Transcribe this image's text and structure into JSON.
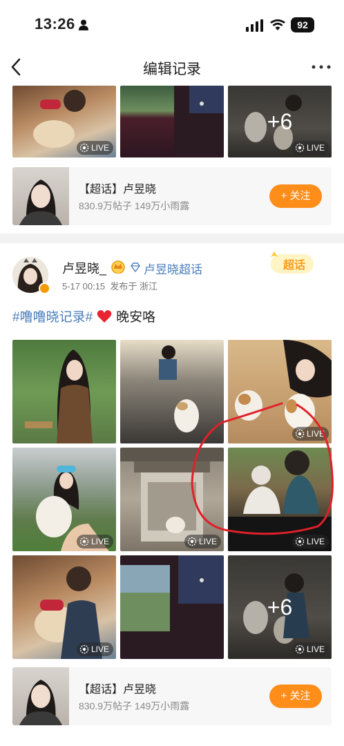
{
  "status_bar": {
    "time": "13:26",
    "battery": "92"
  },
  "nav": {
    "title": "编辑记录"
  },
  "card1": {
    "photos": [
      {
        "live": "LIVE"
      },
      {
        "live": ""
      },
      {
        "live": "LIVE",
        "overlay": "+6"
      }
    ],
    "super_row": {
      "title": "【超话】卢昱晓",
      "stats": "830.9万帖子  149万小雨露",
      "follow": "+ 关注"
    }
  },
  "post": {
    "author": "卢昱晓_",
    "super_link": "卢昱晓超话",
    "sticker": "超话",
    "date": "5-17 00:15",
    "location": "发布于 浙江",
    "hashtag": "#噜噜晓记录#",
    "text": "晚安咯",
    "photos": [
      {
        "live": ""
      },
      {
        "live": ""
      },
      {
        "live": "LIVE"
      },
      {
        "live": "LIVE"
      },
      {
        "live": "LIVE"
      },
      {
        "live": "LIVE"
      },
      {
        "live": "LIVE"
      },
      {
        "live": ""
      },
      {
        "live": "LIVE",
        "overlay": "+6"
      }
    ],
    "super_row": {
      "title": "【超话】卢昱晓",
      "stats": "830.9万帖子  149万小雨露",
      "follow": "+ 关注"
    }
  },
  "colors": {
    "accent": "#ff8d1a",
    "link": "#4a7dbd",
    "annotation": "#e0202a"
  },
  "icons": [
    "person-icon",
    "signal-icon",
    "wifi-icon",
    "back-arrow-icon",
    "more-dots-icon",
    "crown-icon",
    "diamond-icon",
    "heart-icon",
    "live-icon"
  ]
}
